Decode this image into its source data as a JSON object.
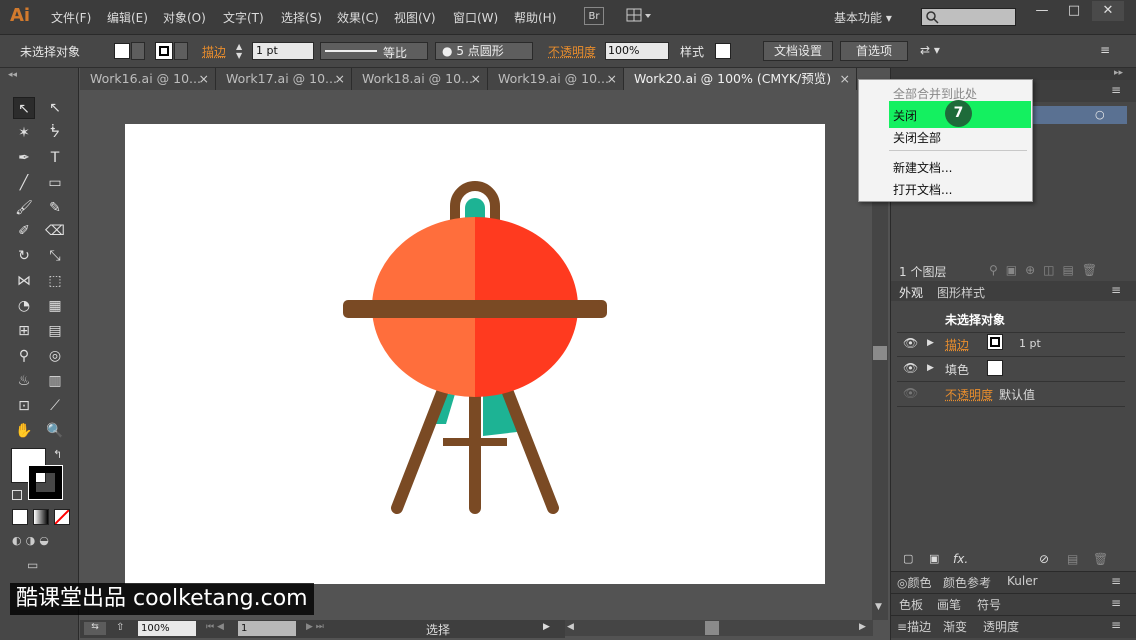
{
  "app": {
    "logo": "Ai",
    "bridge": "Br",
    "workspace": "基本功能 ▾"
  },
  "menu": [
    "文件(F)",
    "编辑(E)",
    "对象(O)",
    "文字(T)",
    "选择(S)",
    "效果(C)",
    "视图(V)",
    "窗口(W)",
    "帮助(H)"
  ],
  "window_controls": {
    "minimize": "—",
    "maximize": "□",
    "close": "✕"
  },
  "control_bar": {
    "selection": "未选择对象",
    "stroke_label": "描边",
    "stroke_weight": "1 pt",
    "stroke_profile": "等比",
    "brush": "5 点圆形",
    "opacity_label": "不透明度",
    "opacity_value": "100%",
    "style_label": "样式",
    "doc_setup": "文档设置",
    "preferences": "首选项"
  },
  "tabs": [
    {
      "label": "Work16.ai @ 10...",
      "close": "×"
    },
    {
      "label": "Work17.ai @ 10...",
      "close": "×"
    },
    {
      "label": "Work18.ai @ 10...",
      "close": "×"
    },
    {
      "label": "Work19.ai @ 10...",
      "close": "×"
    },
    {
      "label": "Work20.ai @ 100% (CMYK/预览)",
      "close": "×"
    }
  ],
  "context_menu": {
    "items": [
      "全部合并到此处",
      "关闭",
      "关闭全部",
      "新建文档...",
      "打开文档..."
    ],
    "step": "7"
  },
  "layers_panel": {
    "count": "1 个图层"
  },
  "appearance_panel": {
    "tabs": [
      "外观",
      "图形样式"
    ],
    "title": "未选择对象",
    "stroke_label": "描边",
    "stroke_value": "1 pt",
    "fill_label": "填色",
    "opacity_label": "不透明度",
    "opacity_value": "默认值",
    "fx": "fx."
  },
  "color_panels": {
    "row1": [
      "颜色",
      "颜色参考",
      "Kuler"
    ],
    "row2": [
      "色板",
      "画笔",
      "符号"
    ],
    "row3": [
      "描边",
      "渐变",
      "透明度"
    ]
  },
  "status_bar": {
    "zoom": "100%",
    "page": "1",
    "mode": "选择"
  },
  "watermark": "酷课堂出品 coolketang.com",
  "colors": {
    "grill_left": "#ff6e3c",
    "grill_right": "#ff3a1f",
    "rail": "#7a4a24",
    "teal": "#1db394",
    "highlight": "#14f060"
  }
}
